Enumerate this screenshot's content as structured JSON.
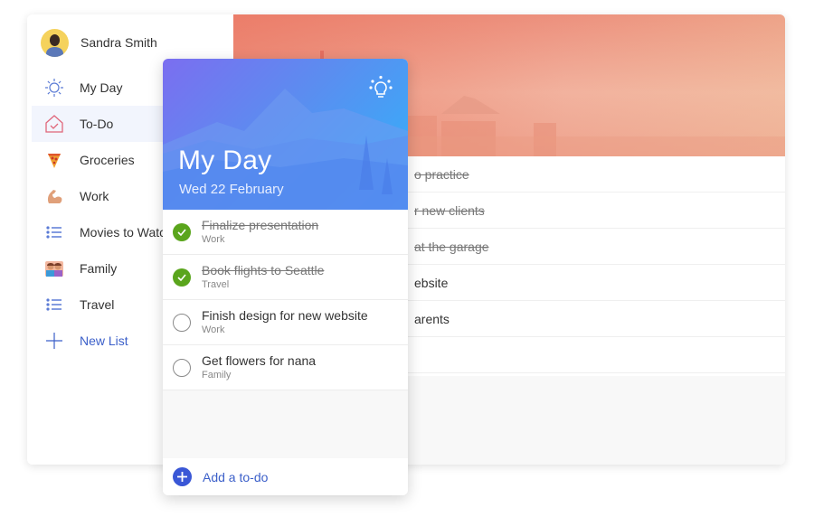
{
  "user": {
    "name": "Sandra Smith"
  },
  "sidebar": {
    "items": [
      {
        "label": "My Day",
        "icon": "sun-icon"
      },
      {
        "label": "To-Do",
        "icon": "home-check-icon",
        "active": true
      },
      {
        "label": "Groceries",
        "icon": "pizza-icon"
      },
      {
        "label": "Work",
        "icon": "flexed-arm-icon"
      },
      {
        "label": "Movies to Watch",
        "icon": "list-icon"
      },
      {
        "label": "Family",
        "icon": "family-icon"
      },
      {
        "label": "Travel",
        "icon": "list-icon"
      },
      {
        "label": "New List",
        "icon": "plus-icon"
      }
    ]
  },
  "background_list": {
    "rows": [
      {
        "text": "o practice",
        "done": true
      },
      {
        "text": "r new clients",
        "done": true
      },
      {
        "text": "at the garage",
        "done": true
      },
      {
        "text": "ebsite",
        "done": false
      },
      {
        "text": "arents",
        "done": false
      },
      {
        "text": "",
        "done": false
      }
    ]
  },
  "myday": {
    "title": "My Day",
    "date": "Wed 22 February",
    "suggestions_icon": "lightbulb-icon",
    "tasks": [
      {
        "title": "Finalize presentation",
        "list": "Work",
        "done": true
      },
      {
        "title": "Book flights to Seattle",
        "list": "Travel",
        "done": true
      },
      {
        "title": "Finish design for new website",
        "list": "Work",
        "done": false
      },
      {
        "title": "Get flowers for nana",
        "list": "Family",
        "done": false
      }
    ],
    "add_label": "Add a to-do"
  },
  "colors": {
    "accent": "#3b5fc9",
    "done_green": "#5aa51c",
    "header_start": "#7b6ef0",
    "header_end": "#2fb4fb",
    "banner": "#ec8f7c"
  }
}
